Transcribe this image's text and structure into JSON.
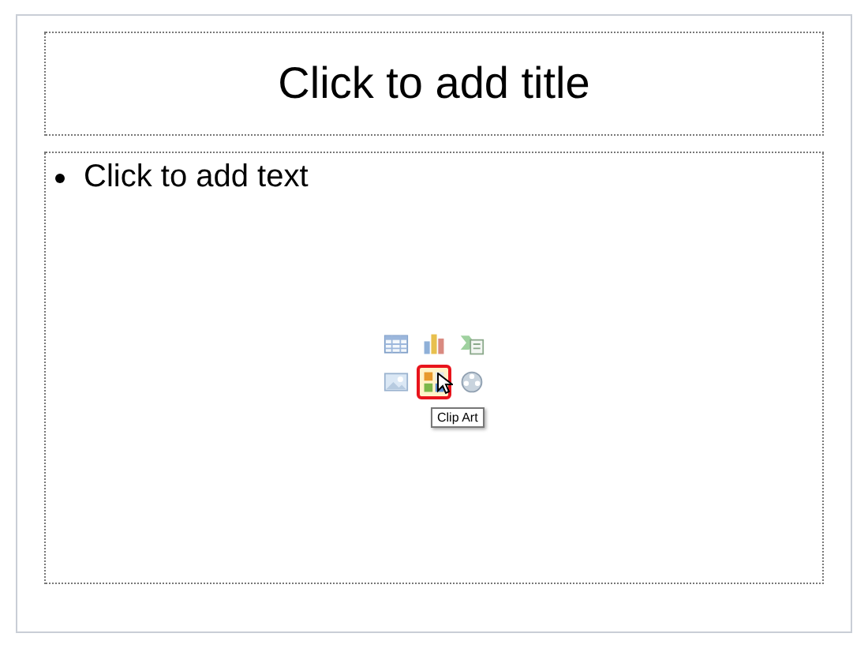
{
  "slide": {
    "title_placeholder": "Click to add title",
    "body_placeholder": "Click to add text"
  },
  "content_icons": [
    {
      "kind": "table",
      "selected": false
    },
    {
      "kind": "chart",
      "selected": false
    },
    {
      "kind": "smartart",
      "selected": false
    },
    {
      "kind": "picture",
      "selected": false
    },
    {
      "kind": "clipart",
      "selected": true
    },
    {
      "kind": "media",
      "selected": false
    }
  ],
  "tooltip": "Clip Art"
}
